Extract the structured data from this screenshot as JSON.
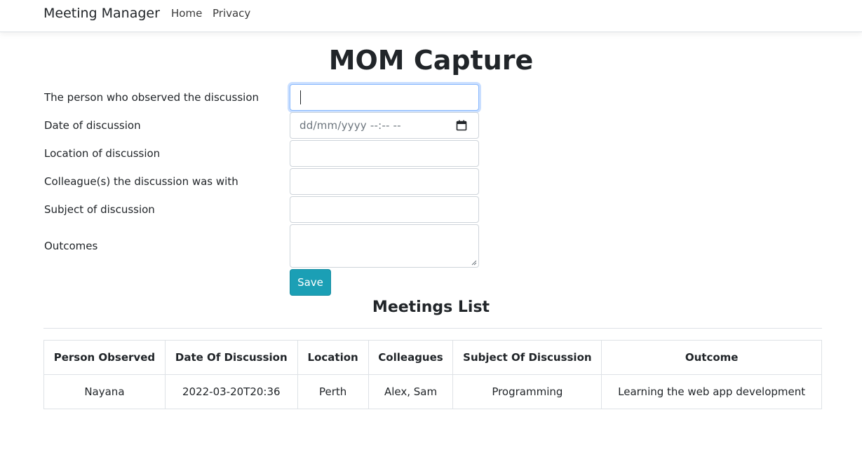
{
  "navbar": {
    "brand": "Meeting Manager",
    "links": [
      "Home",
      "Privacy"
    ]
  },
  "page": {
    "title": "MOM Capture"
  },
  "form": {
    "fields": [
      {
        "label": "The person who observed the discussion",
        "value": ""
      },
      {
        "label": "Date of discussion",
        "value": "",
        "placeholder": "dd/mm/yyyy --:-- --"
      },
      {
        "label": "Location of discussion",
        "value": ""
      },
      {
        "label": "Colleague(s) the discussion was with",
        "value": ""
      },
      {
        "label": "Subject of discussion",
        "value": ""
      },
      {
        "label": "Outcomes",
        "value": ""
      }
    ],
    "save_label": "Save",
    "accent_color": "#1b9fb5"
  },
  "meetings": {
    "title": "Meetings List",
    "headers": [
      "Person Observed",
      "Date Of Discussion",
      "Location",
      "Colleagues",
      "Subject Of Discussion",
      "Outcome"
    ],
    "rows": [
      [
        "Nayana",
        "2022-03-20T20:36",
        "Perth",
        "Alex, Sam",
        "Programming",
        "Learning the web app development"
      ]
    ]
  }
}
